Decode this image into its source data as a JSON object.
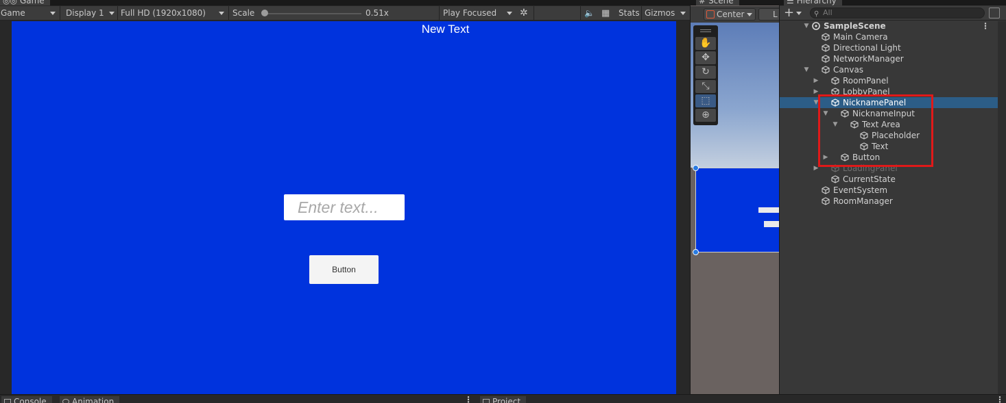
{
  "game_view": {
    "tab_label": "Game",
    "toolbar": {
      "mode": "Game",
      "display": "Display 1",
      "resolution": "Full HD (1920x1080)",
      "scale_label": "Scale",
      "scale_value": "0.51x",
      "scale_fraction": 0.03,
      "play_mode": "Play Focused",
      "stats": "Stats",
      "gizmos": "Gizmos"
    },
    "canvas": {
      "background": "#0033dd",
      "title_text": "New Text",
      "input_placeholder": "Enter text...",
      "button_label": "Button"
    }
  },
  "scene_view": {
    "tab_label": "Scene",
    "pivot_mode": "Center",
    "pivot_rotation": "L"
  },
  "hierarchy": {
    "tab_label": "Hierarchy",
    "search_placeholder": "All",
    "scene_name": "SampleScene",
    "items": [
      {
        "label": "Main Camera",
        "depth": 1,
        "fold": ""
      },
      {
        "label": "Directional Light",
        "depth": 1,
        "fold": ""
      },
      {
        "label": "NetworkManager",
        "depth": 1,
        "fold": ""
      },
      {
        "label": "Canvas",
        "depth": 1,
        "fold": "open"
      },
      {
        "label": "RoomPanel",
        "depth": 2,
        "fold": "closed"
      },
      {
        "label": "LobbyPanel",
        "depth": 2,
        "fold": "closed"
      },
      {
        "label": "NicknamePanel",
        "depth": 2,
        "fold": "open",
        "selected": true
      },
      {
        "label": "NicknameInput",
        "depth": 3,
        "fold": "open"
      },
      {
        "label": "Text Area",
        "depth": 4,
        "fold": "open"
      },
      {
        "label": "Placeholder",
        "depth": 5,
        "fold": ""
      },
      {
        "label": "Text",
        "depth": 5,
        "fold": ""
      },
      {
        "label": "Button",
        "depth": 3,
        "fold": "closed"
      },
      {
        "label": "LoadingPanel",
        "depth": 2,
        "fold": "closed",
        "inactive": true
      },
      {
        "label": "CurrentState",
        "depth": 2,
        "fold": ""
      },
      {
        "label": "EventSystem",
        "depth": 1,
        "fold": ""
      },
      {
        "label": "RoomManager",
        "depth": 1,
        "fold": ""
      }
    ]
  },
  "bottom_tabs": {
    "console": "Console",
    "animation": "Animation",
    "project": "Project"
  },
  "colors": {
    "selection": "#2c5d87",
    "annotation_box": "#e01919",
    "canvas_blue": "#0033dd"
  }
}
